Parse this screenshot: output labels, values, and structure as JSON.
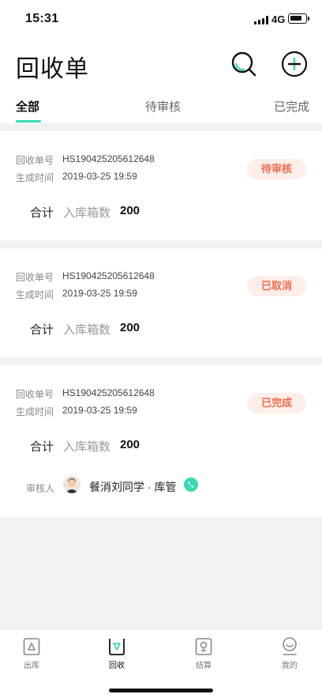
{
  "status_bar": {
    "time": "15:31",
    "network": "4G"
  },
  "header": {
    "title": "回收单",
    "search_icon": "search-icon",
    "add_icon": "plus-circle-icon",
    "accent_color": "#38d9b5"
  },
  "tabs": [
    {
      "label": "全部",
      "active": true
    },
    {
      "label": "待审核",
      "active": false
    },
    {
      "label": "已完成",
      "active": false
    }
  ],
  "orders": [
    {
      "number_label": "回收单号",
      "number": "HS190425205612648",
      "time_label": "生成时间",
      "time": "2019-03-25 19:59",
      "status": "待审核",
      "total_label": "合计",
      "qty_label": "入库箱数",
      "qty": "200"
    },
    {
      "number_label": "回收单号",
      "number": "HS190425205612648",
      "time_label": "生成时间",
      "time": "2019-03-25 19:59",
      "status": "已取消",
      "total_label": "合计",
      "qty_label": "入库箱数",
      "qty": "200"
    },
    {
      "number_label": "回收单号",
      "number": "HS190425205612648",
      "time_label": "生成时间",
      "time": "2019-03-25 19:59",
      "status": "已完成",
      "total_label": "合计",
      "qty_label": "入库箱数",
      "qty": "200",
      "auditor_label": "审核人",
      "auditor_name": "餐消刘同学 · 库管"
    }
  ],
  "status_color": "#f26b4d",
  "bottom_nav": [
    {
      "label": "出库",
      "icon": "outbound-icon",
      "active": false
    },
    {
      "label": "回收",
      "icon": "recycle-icon",
      "active": true
    },
    {
      "label": "结算",
      "icon": "settle-icon",
      "active": false
    },
    {
      "label": "我的",
      "icon": "profile-icon",
      "active": false
    }
  ]
}
